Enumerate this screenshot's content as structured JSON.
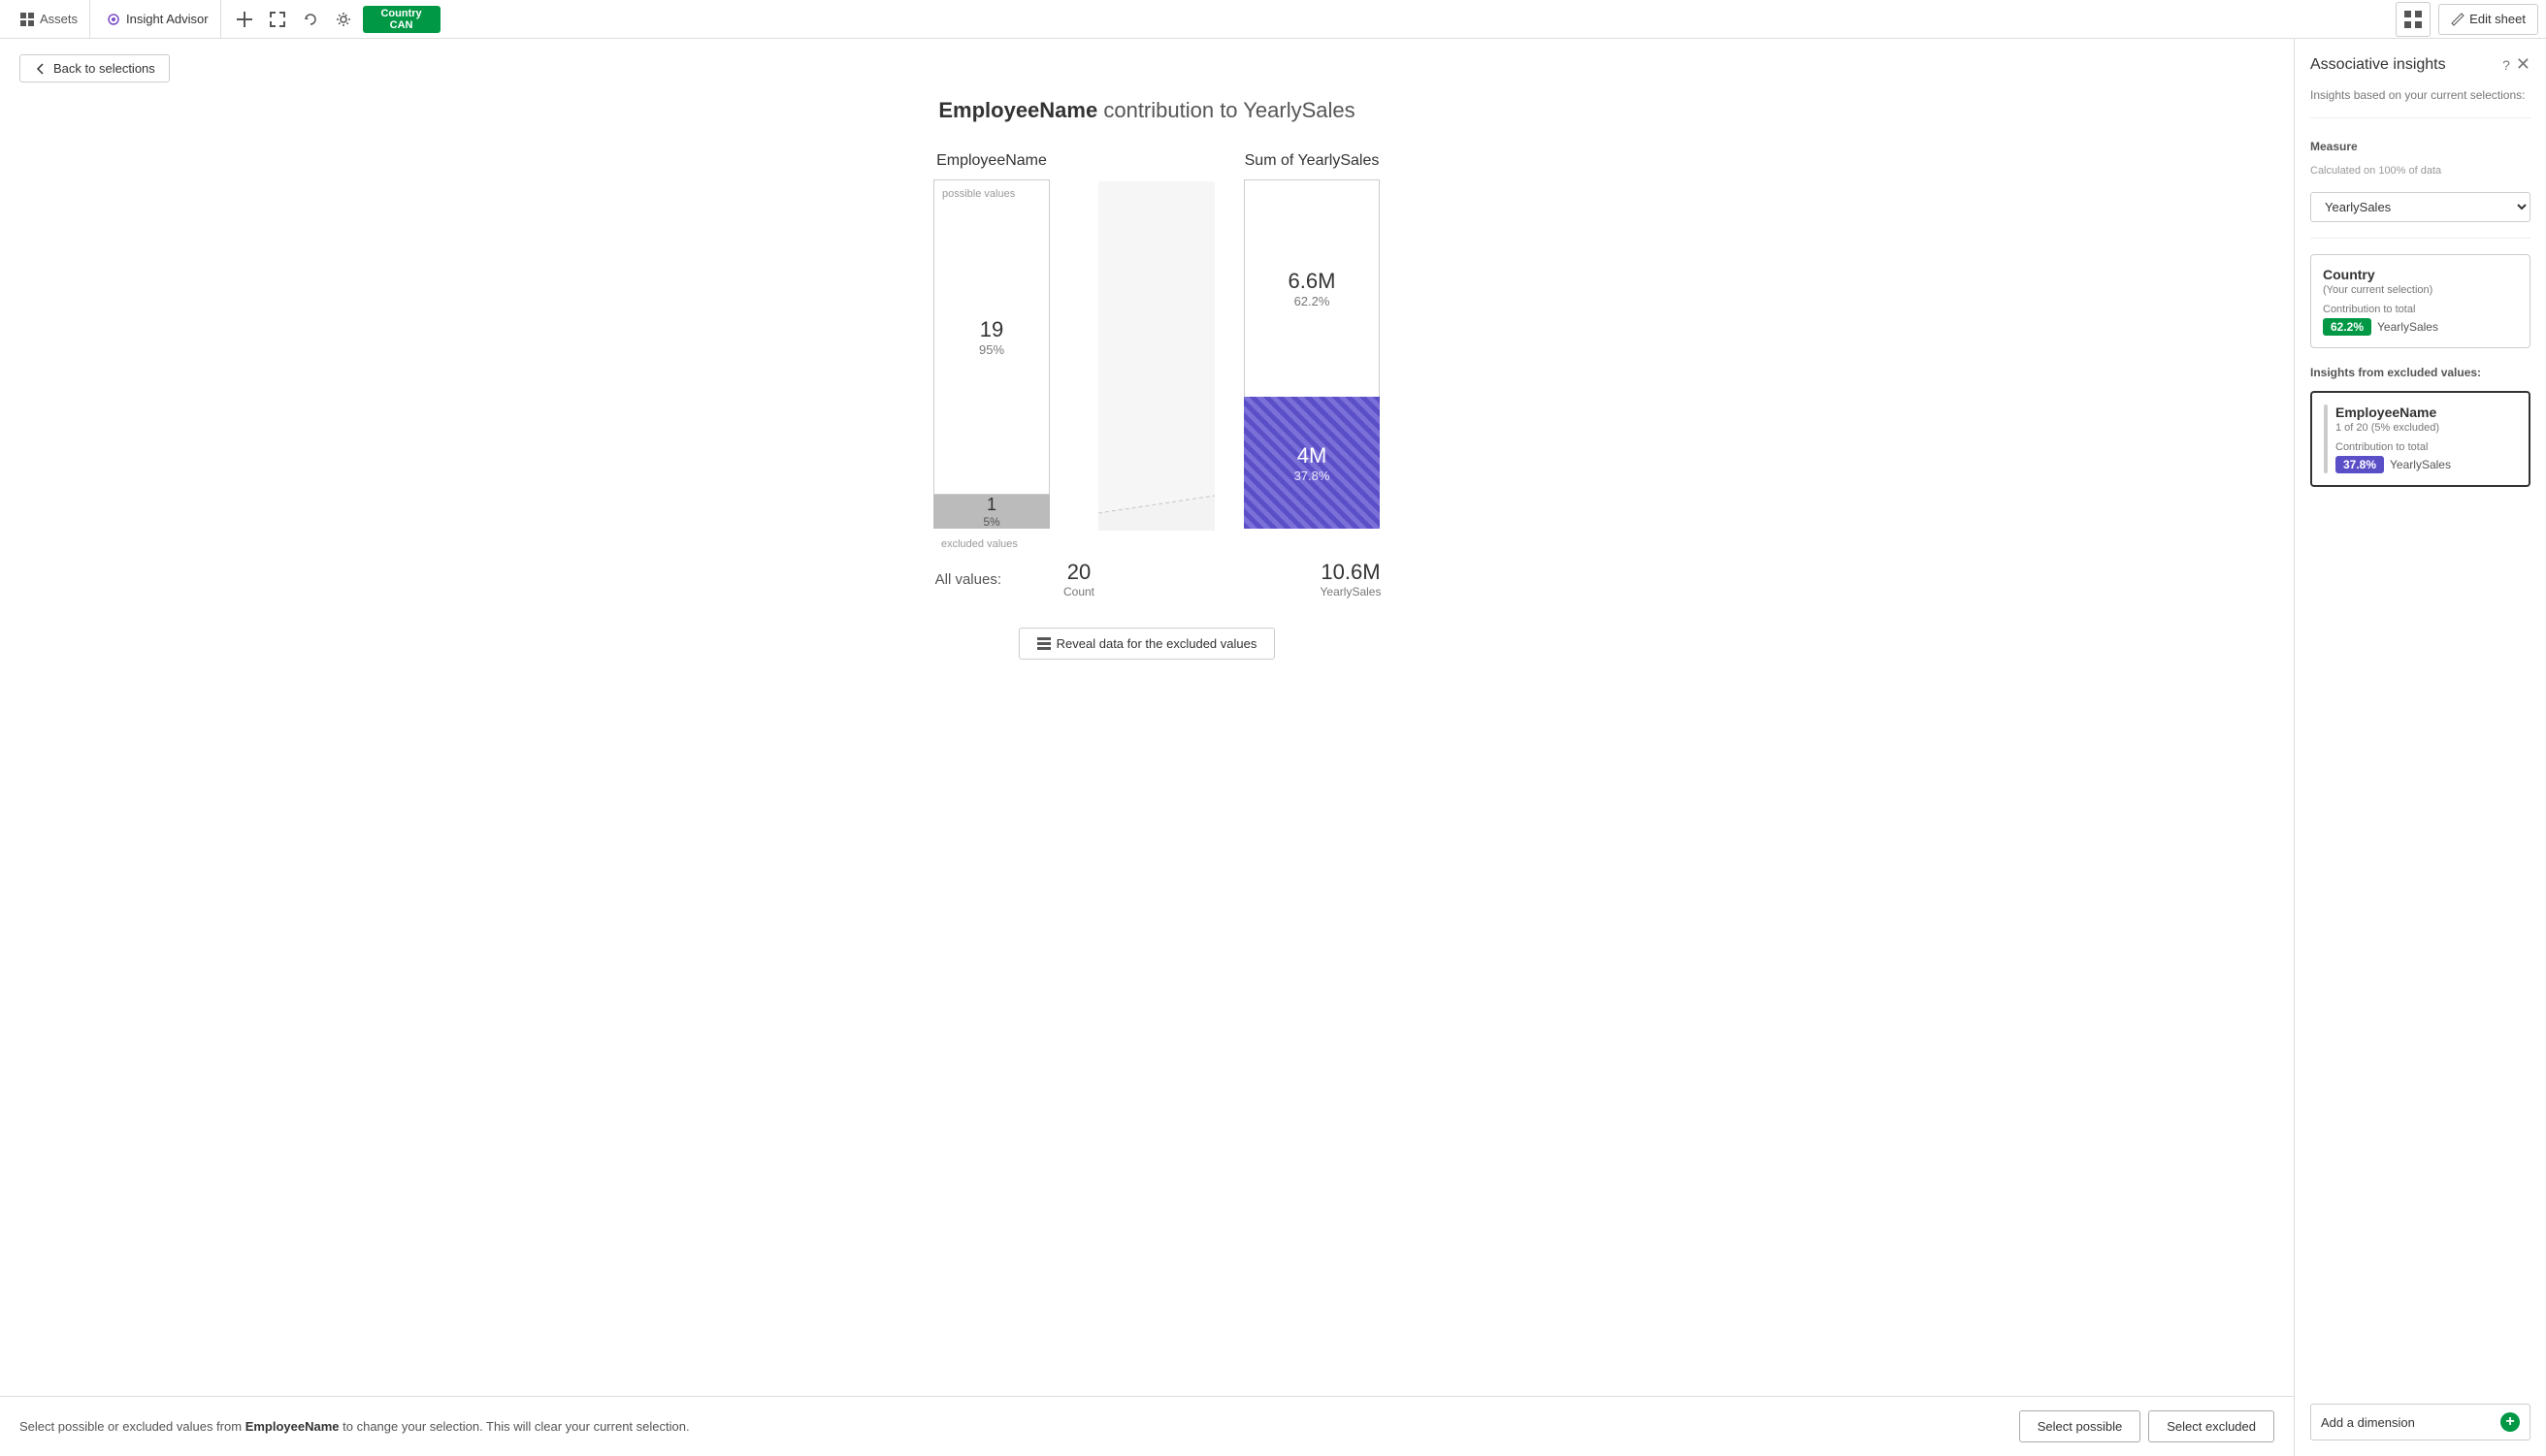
{
  "topbar": {
    "tabs": [
      {
        "id": "assets",
        "label": "Assets",
        "icon": "grid"
      },
      {
        "id": "insight-advisor",
        "label": "Insight Advisor",
        "icon": "sparkle",
        "active": true
      }
    ],
    "icons": [
      "zoom-in",
      "zoom-out",
      "rotate"
    ],
    "selection_pill": {
      "field": "Country",
      "value": "CAN"
    },
    "edit_sheet_label": "Edit sheet"
  },
  "back_button": "Back to selections",
  "chart": {
    "title_field": "EmployeeName",
    "title_text": "contribution to",
    "title_measure": "YearlySales",
    "left_col_header": "EmployeeName",
    "right_col_header": "Sum of YearlySales",
    "possible_label": "possible values",
    "excluded_label": "excluded values",
    "possible_count": "19",
    "possible_pct": "95%",
    "excluded_count": "1",
    "excluded_pct": "5%",
    "possible_sales": "6.6M",
    "possible_sales_pct": "62.2%",
    "excluded_sales": "4M",
    "excluded_sales_pct": "37.8%",
    "all_values_label": "All values:",
    "all_count": "20",
    "all_count_sub": "Count",
    "all_sales": "10.6M",
    "all_sales_sub": "YearlySales"
  },
  "reveal_btn": "Reveal data for the excluded values",
  "bottom_bar": {
    "text": "Select possible or excluded values from",
    "field": "EmployeeName",
    "text2": "to change your selection. This will clear your current selection.",
    "select_possible": "Select possible",
    "select_excluded": "Select excluded"
  },
  "right_panel": {
    "title": "Associative insights",
    "subtitle": "Insights based on your current selections:",
    "help_icon": "question-circle",
    "close_icon": "close",
    "measure_label": "Measure",
    "measure_sub": "Calculated on 100% of data",
    "measure_value": "YearlySales",
    "country_card": {
      "title": "Country",
      "subtitle": "(Your current selection)",
      "contribution_label": "Contribution to total",
      "badge_pct": "62.2%",
      "badge_field": "YearlySales",
      "badge_color": "green"
    },
    "excluded_section_label": "Insights from excluded values:",
    "excluded_card": {
      "title": "EmployeeName",
      "subtitle": "1 of 20 (5% excluded)",
      "contribution_label": "Contribution to total",
      "badge_pct": "37.8%",
      "badge_field": "YearlySales",
      "badge_color": "purple"
    },
    "add_dimension": "Add a dimension"
  }
}
